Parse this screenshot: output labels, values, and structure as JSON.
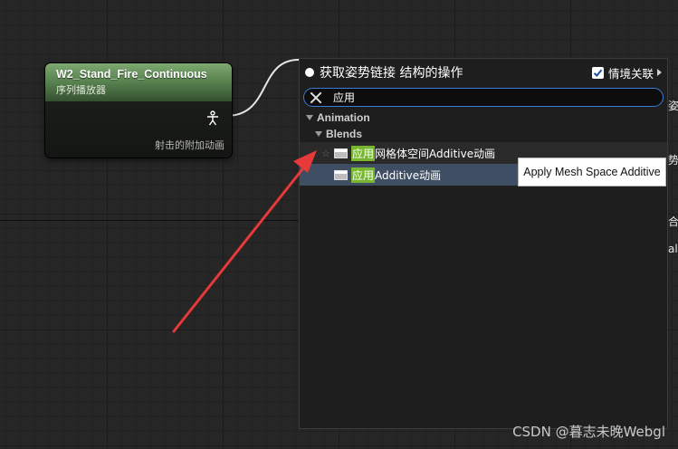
{
  "node": {
    "title": "W2_Stand_Fire_Continuous",
    "subtitle": "序列播放器",
    "output_label": "射击的附加动画",
    "pin_icon": "pose-pin-icon"
  },
  "action_menu": {
    "title": "获取姿势链接 结构的操作",
    "context_sensitive_label": "情境关联",
    "context_sensitive_checked": true,
    "search_value": "应用",
    "categories": [
      {
        "label": "Animation",
        "subcategories": [
          {
            "label": "Blends",
            "items": [
              {
                "highlight": "应用",
                "rest": "网格体空间Additive动画",
                "selected": false
              },
              {
                "highlight": "应用",
                "rest": "Additive动画",
                "selected": true
              }
            ]
          }
        ]
      }
    ]
  },
  "tooltip": {
    "text": "Apply Mesh Space Additive"
  },
  "background_peek": {
    "line1": "姿",
    "line2": "势",
    "line3": "合",
    "line4": "alu"
  },
  "colors": {
    "node_header": "#5a8552",
    "search_highlight": "#77b62e",
    "selected_row": "#3f4e62",
    "search_border": "#3d7bd8",
    "annotation_arrow": "#e8393a"
  },
  "watermark": "CSDN @暮志未晚Webgl"
}
